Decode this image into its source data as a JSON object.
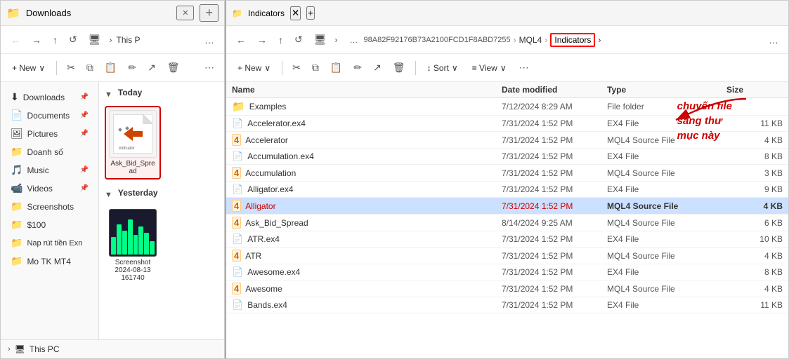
{
  "left_window": {
    "title": "Downloads",
    "tab_close": "✕",
    "new_tab": "+",
    "nav": {
      "back": "←",
      "forward": "→",
      "up": "↑",
      "refresh": "↺",
      "monitor_icon": "🖥",
      "more": "…",
      "path": "This P"
    },
    "toolbar": {
      "new_label": "+ New",
      "new_dropdown": "∨",
      "cut": "✂",
      "copy": "⧉",
      "paste": "📋",
      "rename": "✏",
      "share": "↗",
      "delete": "🗑",
      "more": "⋯"
    },
    "sidebar": {
      "items": [
        {
          "id": "downloads",
          "label": "Downloads",
          "icon": "⬇",
          "pinned": true
        },
        {
          "id": "documents",
          "label": "Documents",
          "icon": "📄",
          "pinned": true
        },
        {
          "id": "pictures",
          "label": "Pictures",
          "icon": "🖼",
          "pinned": true
        },
        {
          "id": "doanh-so",
          "label": "Doanh số",
          "icon": "📁",
          "pinned": false
        },
        {
          "id": "music",
          "label": "Music",
          "icon": "🎵",
          "pinned": true
        },
        {
          "id": "videos",
          "label": "Videos",
          "icon": "📹",
          "pinned": true
        },
        {
          "id": "screenshots",
          "label": "Screenshots",
          "icon": "📁",
          "pinned": false
        },
        {
          "id": "s100",
          "label": "$100",
          "icon": "📁",
          "pinned": false
        },
        {
          "id": "nap-rut",
          "label": "Nap rút tiền Exn",
          "icon": "📁",
          "pinned": false
        },
        {
          "id": "mo-tk",
          "label": "Mo TK MT4",
          "icon": "📁",
          "pinned": false
        }
      ]
    },
    "main": {
      "sections": [
        {
          "label": "Today",
          "files": [
            {
              "id": "ask-bid-spread",
              "name": "Ask_Bid_Spread",
              "type": "indicator",
              "selected": true
            }
          ]
        },
        {
          "label": "Yesterday",
          "files": [
            {
              "id": "screenshot",
              "name": "Screenshot 2024-08-13 161740",
              "type": "screenshot"
            }
          ]
        }
      ]
    }
  },
  "right_window": {
    "title": "Indicators",
    "tab_close": "✕",
    "new_tab": "+",
    "nav": {
      "back": "←",
      "forward": "→",
      "up": "↑",
      "refresh": "↺",
      "monitor_icon": "🖥",
      "more": "…",
      "breadcrumb": {
        "hash": "98A82F92176B73A2100FCD1F8ABD7255",
        "mql4": "MQL4",
        "indicators": "Indicators",
        "chevron": "›"
      }
    },
    "toolbar": {
      "new_label": "+ New",
      "new_dropdown": "∨",
      "cut": "✂",
      "copy": "⧉",
      "paste": "📋",
      "rename": "✏",
      "share": "↗",
      "delete": "🗑",
      "sort": "↕ Sort",
      "sort_dropdown": "∨",
      "view": "≡ View",
      "view_dropdown": "∨",
      "more": "⋯"
    },
    "table": {
      "headers": [
        "Name",
        "Date modified",
        "Type",
        "Size"
      ],
      "rows": [
        {
          "id": "examples",
          "name": "Examples",
          "type_icon": "folder",
          "date": "7/12/2024 8:29 AM",
          "file_type": "File folder",
          "size": ""
        },
        {
          "id": "accelerator-ex4",
          "name": "Accelerator.ex4",
          "type_icon": "ex4",
          "date": "7/31/2024 1:52 PM",
          "file_type": "EX4 File",
          "size": "11 KB"
        },
        {
          "id": "accelerator",
          "name": "Accelerator",
          "type_icon": "mql4",
          "date": "7/31/2024 1:52 PM",
          "file_type": "MQL4 Source File",
          "size": "4 KB"
        },
        {
          "id": "accumulation-ex4",
          "name": "Accumulation.ex4",
          "type_icon": "ex4",
          "date": "7/31/2024 1:52 PM",
          "file_type": "EX4 File",
          "size": "8 KB"
        },
        {
          "id": "accumulation",
          "name": "Accumulation",
          "type_icon": "mql4",
          "date": "7/31/2024 1:52 PM",
          "file_type": "MQL4 Source File",
          "size": "3 KB"
        },
        {
          "id": "alligator-ex4",
          "name": "Alligator.ex4",
          "type_icon": "ex4",
          "date": "7/31/2024 1:52 PM",
          "file_type": "EX4 File",
          "size": "9 KB"
        },
        {
          "id": "alligator",
          "name": "Alligator",
          "type_icon": "mql4",
          "date": "7/31/2024 1:52 PM",
          "file_type": "MQL4 Source File",
          "size": "4 KB",
          "selected": true
        },
        {
          "id": "ask-bid-spread",
          "name": "Ask_Bid_Spread",
          "type_icon": "mql4",
          "date": "8/14/2024 9:25 AM",
          "file_type": "MQL4 Source File",
          "size": "6 KB"
        },
        {
          "id": "atr-ex4",
          "name": "ATR.ex4",
          "type_icon": "ex4",
          "date": "7/31/2024 1:52 PM",
          "file_type": "EX4 File",
          "size": "10 KB"
        },
        {
          "id": "atr",
          "name": "ATR",
          "type_icon": "mql4",
          "date": "7/31/2024 1:52 PM",
          "file_type": "MQL4 Source File",
          "size": "4 KB"
        },
        {
          "id": "awesome-ex4",
          "name": "Awesome.ex4",
          "type_icon": "ex4",
          "date": "7/31/2024 1:52 PM",
          "file_type": "EX4 File",
          "size": "8 KB"
        },
        {
          "id": "awesome",
          "name": "Awesome",
          "type_icon": "mql4",
          "date": "7/31/2024 1:52 PM",
          "file_type": "MQL4 Source File",
          "size": "4 KB"
        },
        {
          "id": "bands-ex4",
          "name": "Bands.ex4",
          "type_icon": "ex4",
          "date": "7/31/2024 1:52 PM",
          "file_type": "EX4 File",
          "size": "11 KB"
        }
      ]
    }
  },
  "annotation": {
    "line1": "chuyến file",
    "line2": "sang thư",
    "line3": "mục này"
  },
  "this_pc": {
    "label": "This PC",
    "icon": "🖥"
  }
}
